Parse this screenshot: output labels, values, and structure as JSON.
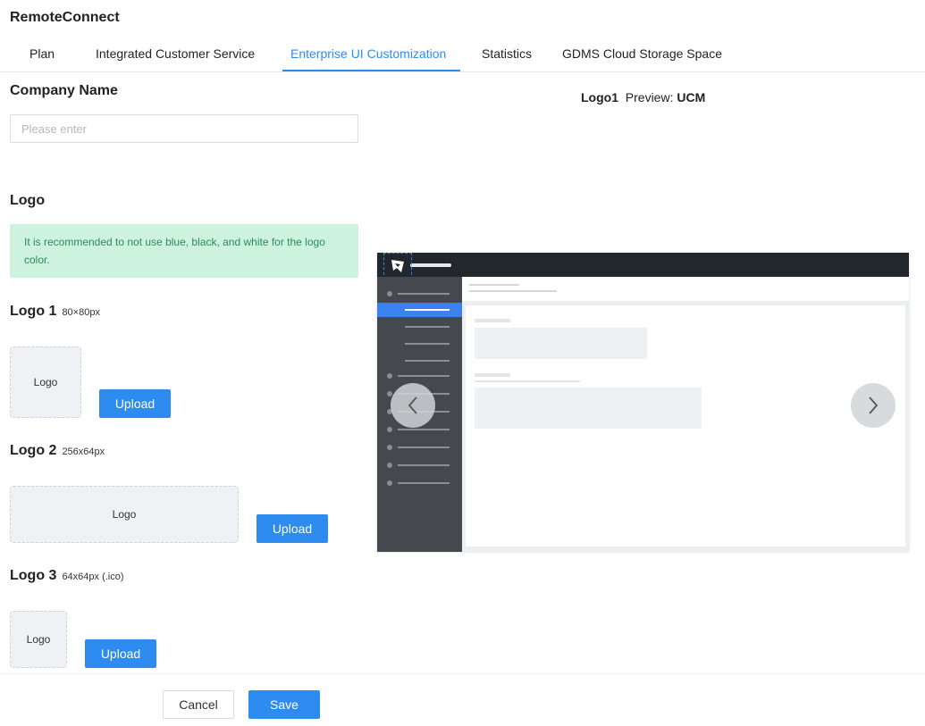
{
  "app": {
    "title": "RemoteConnect"
  },
  "tabs": [
    {
      "label": "Plan",
      "active": false
    },
    {
      "label": "Integrated Customer Service",
      "active": false
    },
    {
      "label": "Enterprise UI Customization",
      "active": true
    },
    {
      "label": "Statistics",
      "active": false
    },
    {
      "label": "GDMS Cloud Storage Space",
      "active": false
    }
  ],
  "company": {
    "title": "Company Name",
    "input_value": "",
    "placeholder": "Please enter"
  },
  "logo_section": {
    "title": "Logo",
    "tip": "It is recommended to not use blue, black, and white for the logo color."
  },
  "logos": [
    {
      "title": "Logo 1",
      "size": "80×80px",
      "box_label": "Logo",
      "upload_label": "Upload"
    },
    {
      "title": "Logo 2",
      "size": "256x64px",
      "box_label": "Logo",
      "upload_label": "Upload"
    },
    {
      "title": "Logo 3",
      "size": "64x64px (.ico)",
      "box_label": "Logo",
      "upload_label": "Upload"
    }
  ],
  "preview": {
    "logo_name": "Logo1",
    "preview_label": "Preview:",
    "preview_target": "UCM"
  },
  "footer": {
    "cancel_label": "Cancel",
    "save_label": "Save"
  },
  "colors": {
    "accent": "#2e8cf0",
    "tip_background": "#cdf2de",
    "tip_text": "#2e8a5a",
    "preview_topbar": "#22262d",
    "preview_sidebar": "#45484e",
    "preview_active": "#3b82f0"
  },
  "icons": {
    "prev": "chevron-left-icon",
    "next": "chevron-right-icon",
    "preview_logo": "brand-logo-icon"
  }
}
